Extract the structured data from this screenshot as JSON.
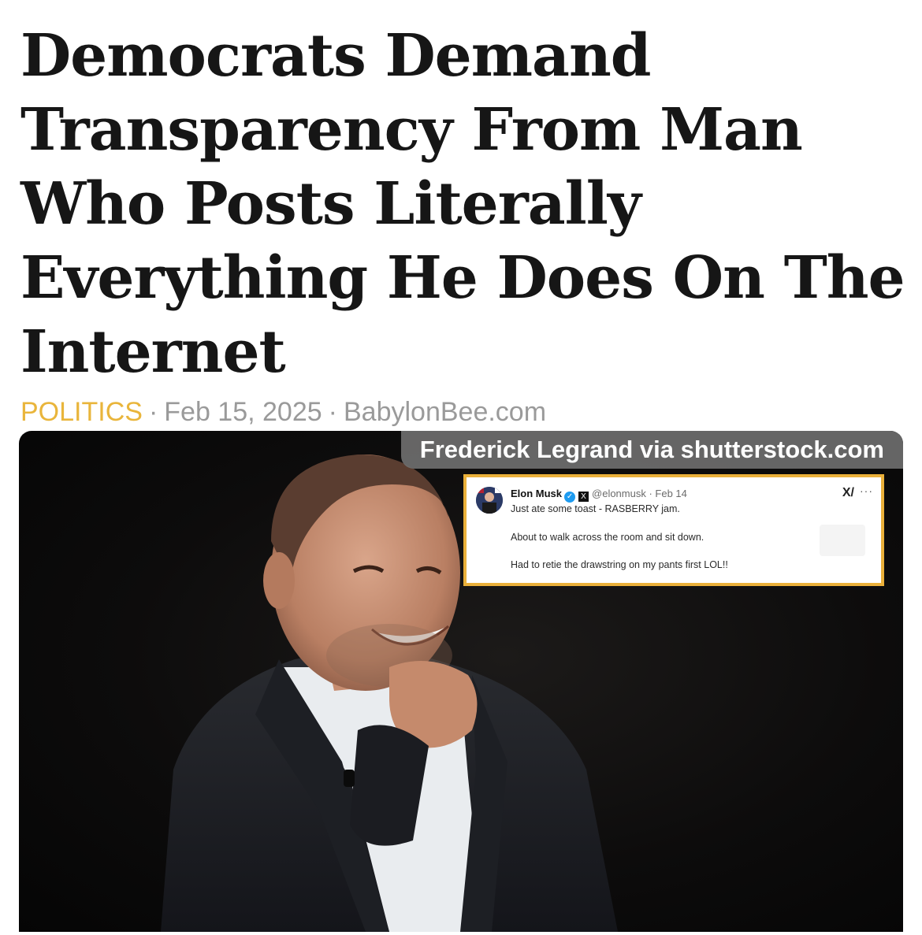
{
  "article": {
    "headline": "Democrats Demand Transparency From Man Who Posts Literally Everything He Does On The Internet",
    "category": "POLITICS",
    "date": "Feb 15, 2025",
    "source": "BabylonBee.com",
    "separator": "·"
  },
  "image": {
    "credit": "Frederick Legrand via shutterstock.com"
  },
  "tweet": {
    "name": "Elon Musk",
    "handle": "@elonmusk",
    "date": "Feb 14",
    "line1": "Just ate some toast - RASBERRY jam.",
    "line2": "About to walk across the room and sit down.",
    "line3": "Had to retie the drawstring on my pants first LOL!!",
    "grok_glyph": "X/",
    "more_glyph": "···",
    "verified_glyph": "✓",
    "x_glyph": "X"
  },
  "colors": {
    "category": "#e9b53b",
    "meta": "#9a9a9a",
    "tweet_border": "#eab03a",
    "headline": "#161616"
  }
}
